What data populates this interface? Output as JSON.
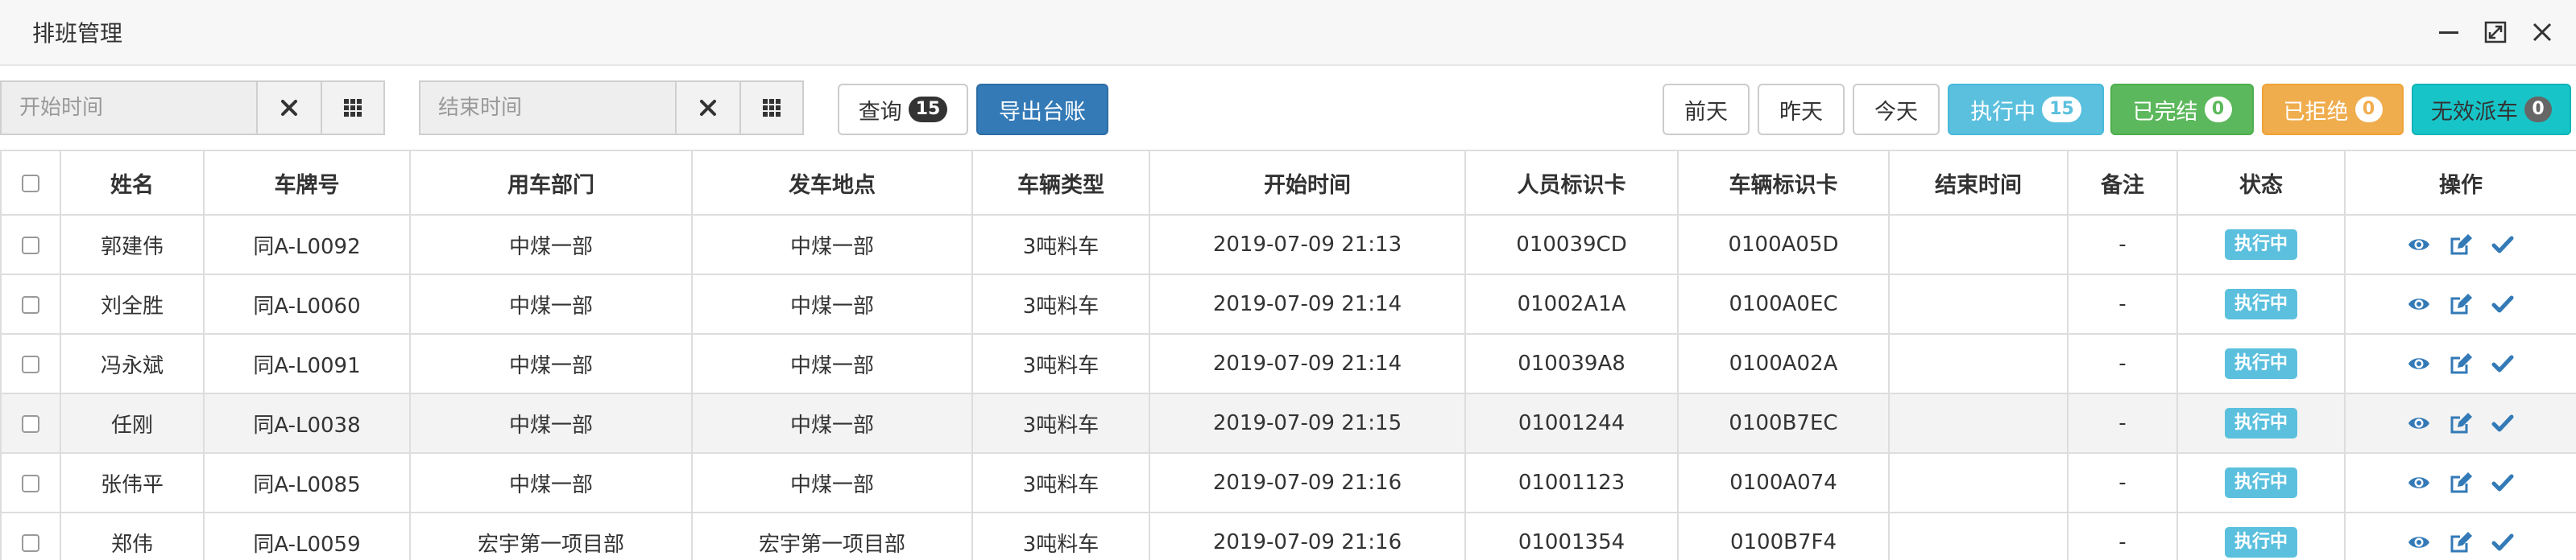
{
  "window": {
    "title": "排班管理"
  },
  "toolbar": {
    "start_placeholder": "开始时间",
    "end_placeholder": "结束时间",
    "query_label": "查询",
    "query_count": "15",
    "export_label": "导出台账",
    "prev_day_label": "前天",
    "yesterday_label": "昨天",
    "today_label": "今天",
    "running_label": "执行中",
    "running_count": "15",
    "done_label": "已完结",
    "done_count": "0",
    "rejected_label": "已拒绝",
    "rejected_count": "0",
    "invalid_label": "无效派车",
    "invalid_count": "0"
  },
  "colors": {
    "primary": "#337ab7",
    "info": "#5bc0de",
    "success": "#5cb85c",
    "warning": "#f0ad4e",
    "teal": "#17c5c8"
  },
  "table": {
    "headers": [
      "姓名",
      "车牌号",
      "用车部门",
      "发车地点",
      "车辆类型",
      "开始时间",
      "人员标识卡",
      "车辆标识卡",
      "结束时间",
      "备注",
      "状态",
      "操作"
    ],
    "rows": [
      {
        "name": "郭建伟",
        "plate": "同A-L0092",
        "dept": "中煤一部",
        "location": "中煤一部",
        "type": "3吨料车",
        "start": "2019-07-09 21:13",
        "person_card": "010039CD",
        "vehicle_card": "0100A05D",
        "end": "",
        "remark": "-",
        "status": "执行中"
      },
      {
        "name": "刘全胜",
        "plate": "同A-L0060",
        "dept": "中煤一部",
        "location": "中煤一部",
        "type": "3吨料车",
        "start": "2019-07-09 21:14",
        "person_card": "01002A1A",
        "vehicle_card": "0100A0EC",
        "end": "",
        "remark": "-",
        "status": "执行中"
      },
      {
        "name": "冯永斌",
        "plate": "同A-L0091",
        "dept": "中煤一部",
        "location": "中煤一部",
        "type": "3吨料车",
        "start": "2019-07-09 21:14",
        "person_card": "010039A8",
        "vehicle_card": "0100A02A",
        "end": "",
        "remark": "-",
        "status": "执行中"
      },
      {
        "name": "任刚",
        "plate": "同A-L0038",
        "dept": "中煤一部",
        "location": "中煤一部",
        "type": "3吨料车",
        "start": "2019-07-09 21:15",
        "person_card": "01001244",
        "vehicle_card": "0100B7EC",
        "end": "",
        "remark": "-",
        "status": "执行中"
      },
      {
        "name": "张伟平",
        "plate": "同A-L0085",
        "dept": "中煤一部",
        "location": "中煤一部",
        "type": "3吨料车",
        "start": "2019-07-09 21:16",
        "person_card": "01001123",
        "vehicle_card": "0100A074",
        "end": "",
        "remark": "-",
        "status": "执行中"
      },
      {
        "name": "郑伟",
        "plate": "同A-L0059",
        "dept": "宏宇第一项目部",
        "location": "宏宇第一项目部",
        "type": "3吨料车",
        "start": "2019-07-09 21:16",
        "person_card": "01001354",
        "vehicle_card": "0100B7F4",
        "end": "",
        "remark": "-",
        "status": "执行中"
      }
    ]
  }
}
